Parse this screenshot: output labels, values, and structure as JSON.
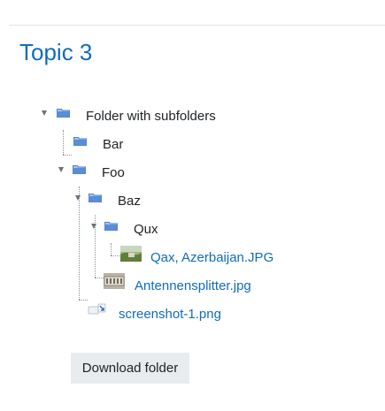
{
  "section": {
    "title": "Topic 3"
  },
  "tree": {
    "root": "Folder with subfolders",
    "bar": "Bar",
    "foo": "Foo",
    "baz": "Baz",
    "qux": "Qux",
    "file_qax": "Qax, Azerbaijan.JPG",
    "file_antenna": "Antennensplitter.jpg",
    "file_screenshot": "screenshot-1.png"
  },
  "actions": {
    "download_label": "Download folder"
  },
  "icons": {
    "folder": "folder-icon",
    "expanded": "expanded-triangle-icon",
    "image_thumbnail": "image-thumbnail-icon"
  },
  "colors": {
    "link": "#0f6cbf",
    "button_bg": "#e9ecef",
    "folder_blue": "#5b8dd6"
  }
}
